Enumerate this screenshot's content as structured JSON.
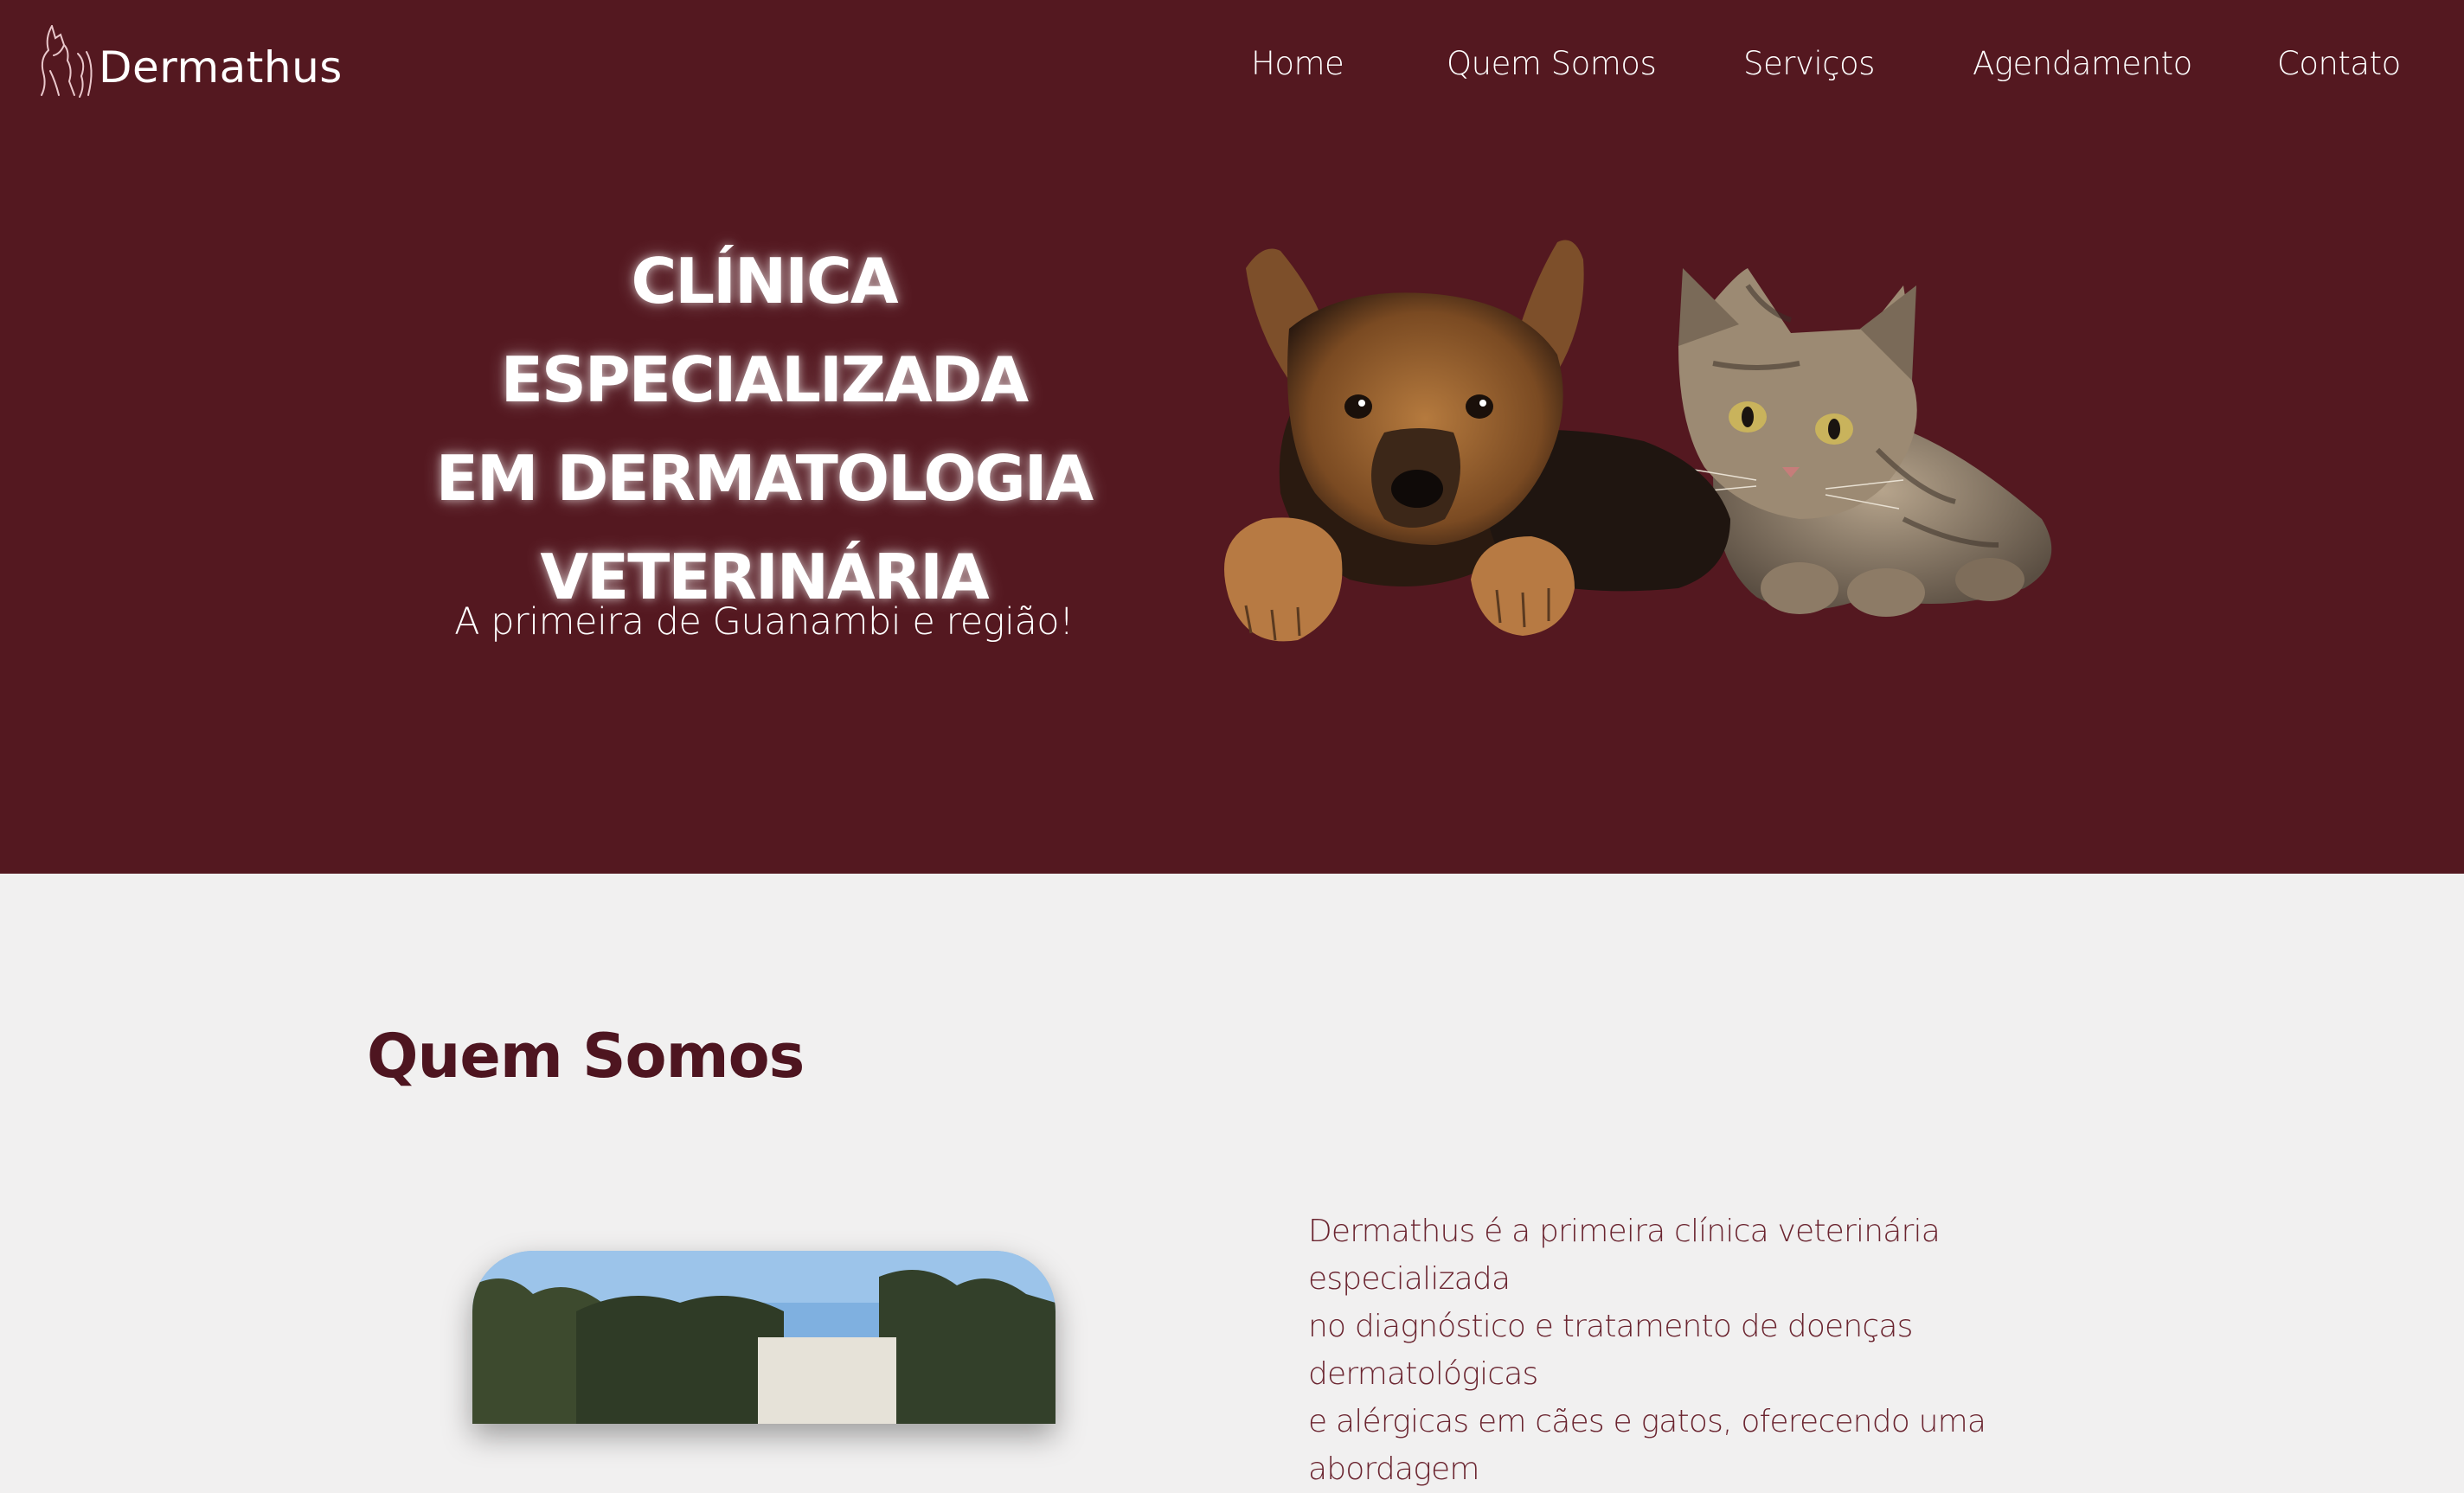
{
  "brand": {
    "name": "Dermathus",
    "accent": "#541820",
    "text_accent": "#4e1520"
  },
  "nav": {
    "home": "Home",
    "quem_somos": "Quem Somos",
    "servicos": "Serviços",
    "agendamento": "Agendamento",
    "contato": "Contato"
  },
  "hero": {
    "title_line1": "CLÍNICA ESPECIALIZADA",
    "title_line2": "EM DERMATOLOGIA",
    "title_line3": "VETERINÁRIA",
    "subtitle": "A primeira de Guanambi e região!"
  },
  "about": {
    "title": "Quem Somos",
    "text_line1": "Dermathus é a primeira clínica veterinária especializada",
    "text_line2": "no diagnóstico e tratamento de doenças dermatológicas",
    "text_line3": "e alérgicas em cães e gatos, oferecendo uma abordagem"
  }
}
